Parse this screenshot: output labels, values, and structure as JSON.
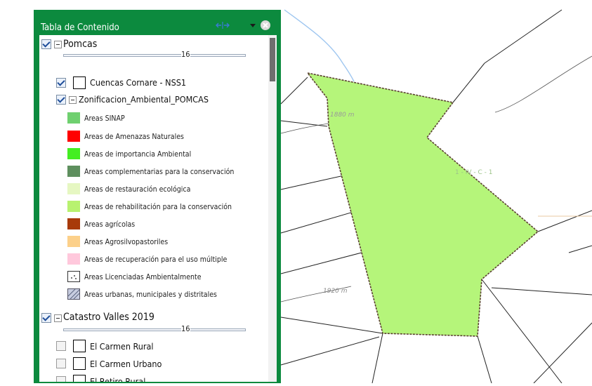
{
  "toc": {
    "title": "Tabla de Contenido",
    "colors": {
      "header_bg": "#0c8a3e"
    },
    "header_icons": [
      "expand-collapse-icon",
      "options-dropdown-icon",
      "close-icon"
    ],
    "pomcas": {
      "label": "Pomcas",
      "checked": true,
      "expanded": true,
      "opacity_value": "16",
      "layers": [
        {
          "label": "Cuencas Cornare - NSS1",
          "checked": true
        },
        {
          "label": "Zonificacion_Ambiental_POMCAS",
          "checked": true,
          "expanded": true
        }
      ],
      "legend": [
        {
          "label": "Areas SINAP",
          "color": "#6fd06f"
        },
        {
          "label": "Areas de Amenazas Naturales",
          "color": "#ff0000"
        },
        {
          "label": "Areas de importancia Ambiental",
          "color": "#44ee22"
        },
        {
          "label": "Areas complementarias para la conservación",
          "color": "#5e8f5e"
        },
        {
          "label": "Areas de restauración ecológica",
          "color": "#e6f7c2"
        },
        {
          "label": "Areas de rehabilitación para la conservación",
          "color": "#b8f270"
        },
        {
          "label": "Areas agrícolas",
          "color": "#a83a0a"
        },
        {
          "label": "Areas Agrosilvopastoriles",
          "color": "#fcd08a"
        },
        {
          "label": "Areas de recuperación para el uso múltiple",
          "color": "#ffc8dc"
        },
        {
          "label": "Areas Licenciadas Ambientalmente",
          "color": "#ffffff"
        },
        {
          "label": "Areas urbanas, municipales y distritales",
          "color": "#c8cde0"
        }
      ]
    },
    "catastro": {
      "label": "Catastro Valles 2019",
      "checked": true,
      "expanded": true,
      "opacity_value": "16",
      "layers": [
        {
          "label": "El Carmen Rural",
          "checked": false
        },
        {
          "label": "El Carmen Urbano",
          "checked": false
        },
        {
          "label": "El Retiro Rural",
          "checked": false
        }
      ]
    }
  },
  "map": {
    "contour_labels": [
      "1880 m",
      "1920 m"
    ],
    "parcel_label": "1 - IV - C - 1",
    "colors": {
      "selected_polygon": "#b5f57a",
      "outline": "#5a4030"
    }
  }
}
